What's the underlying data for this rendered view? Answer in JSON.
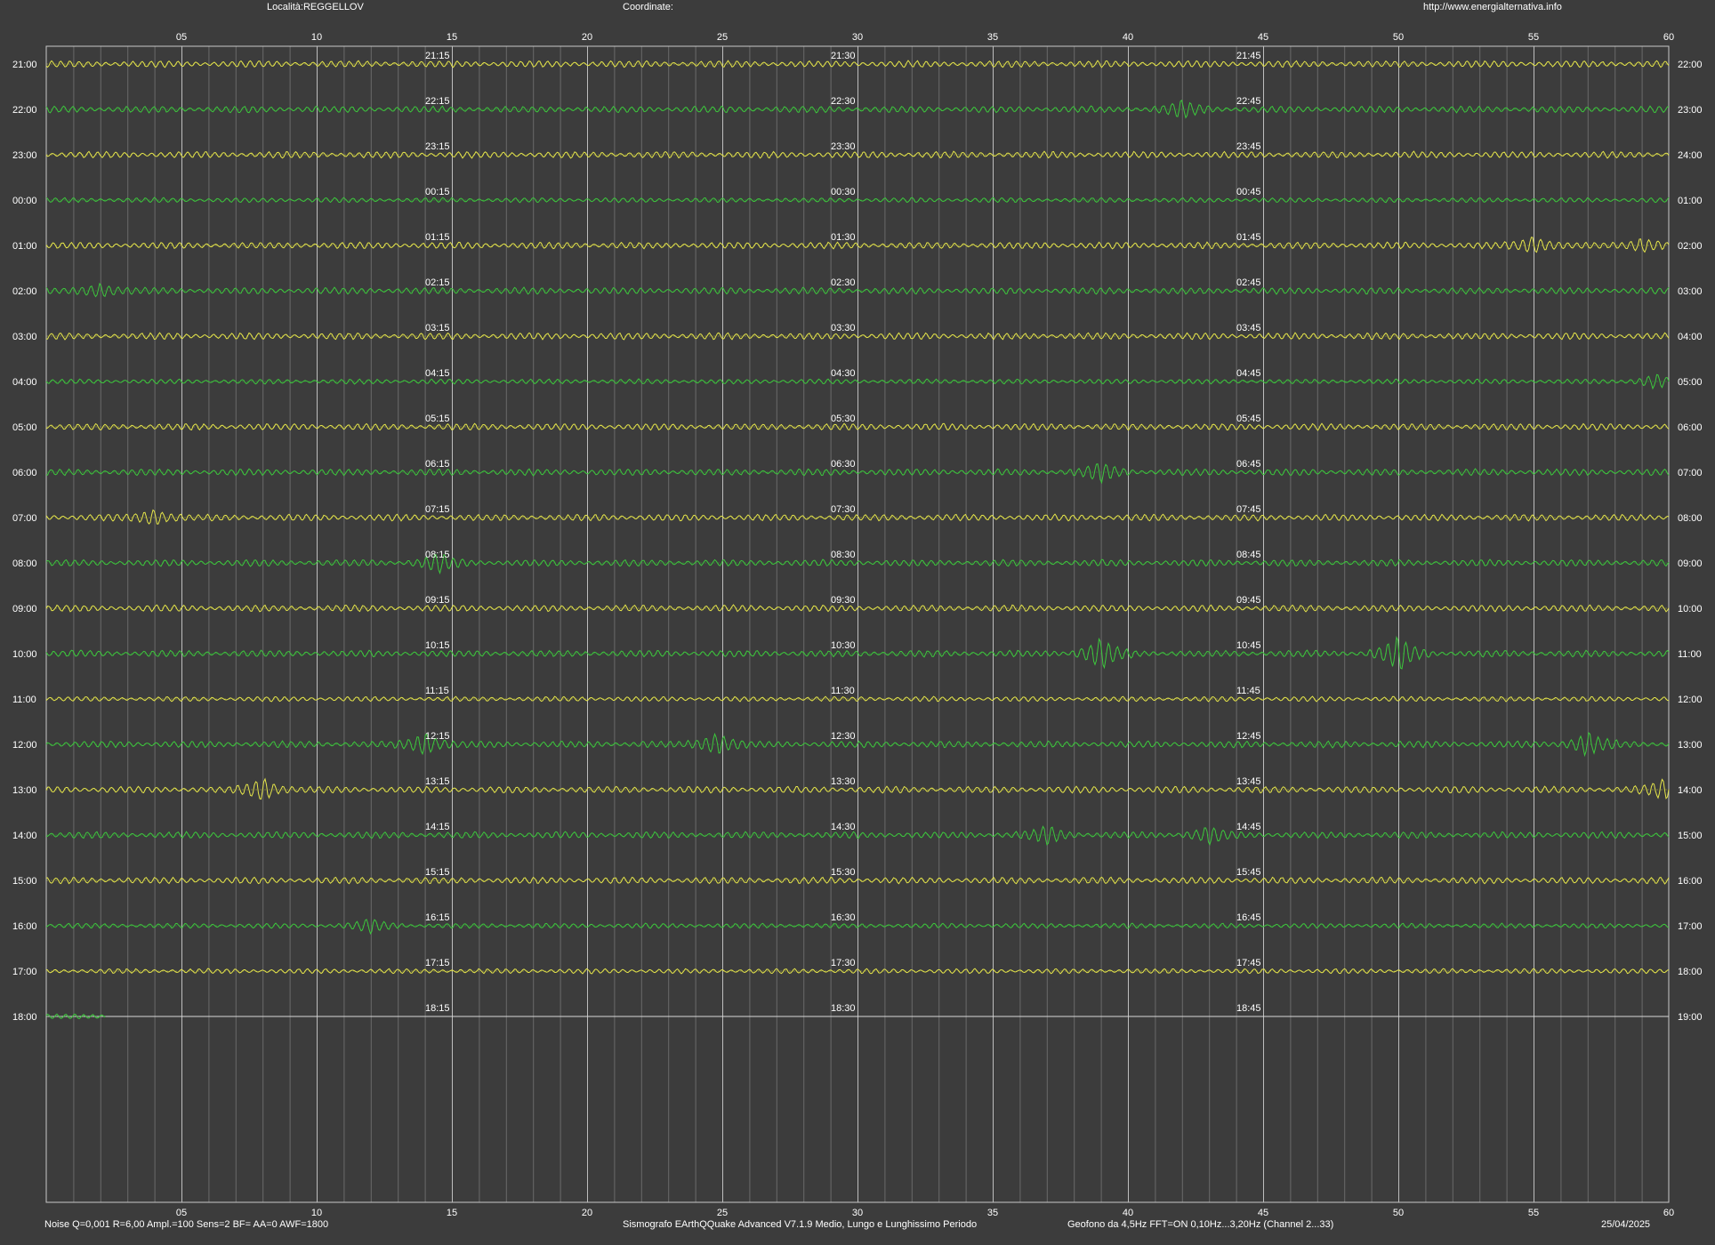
{
  "header": {
    "location": "Località:REGGELLOV",
    "coordinates": "Coordinate:",
    "url": "http://www.energialternativa.info"
  },
  "footer": {
    "noise": "Noise Q=0,001 R=6,00 Ampl.=100 Sens=2 BF= AA=0 AWF=1800",
    "software": "Sismografo  EArthQQuake Advanced V7.1.9  Medio, Lungo e Lunghissimo Periodo",
    "sensor": "Geofono da 4,5Hz FFT=ON 0,10Hz...3,20Hz      (Channel 2...33)",
    "date": "25/04/2025"
  },
  "chart_data": {
    "type": "line",
    "title": "",
    "xlabel": "",
    "ylabel": "",
    "x_ticks": [
      "05",
      "10",
      "15",
      "20",
      "25",
      "30",
      "35",
      "40",
      "45",
      "50",
      "55",
      "60"
    ],
    "xlim": [
      0,
      60
    ],
    "rows": [
      {
        "left": "21:00",
        "right": "22:00",
        "q1": "21:15",
        "q2": "21:30",
        "q3": "21:45",
        "color": "#e6e64a",
        "amp": 4,
        "complete": true,
        "events": []
      },
      {
        "left": "22:00",
        "right": "23:00",
        "q1": "22:15",
        "q2": "22:30",
        "q3": "22:45",
        "color": "#3cc83c",
        "amp": 4,
        "complete": true,
        "events": [
          {
            "minute": 42,
            "amp": 8
          }
        ]
      },
      {
        "left": "23:00",
        "right": "24:00",
        "q1": "23:15",
        "q2": "23:30",
        "q3": "23:45",
        "color": "#e6e64a",
        "amp": 4,
        "complete": true,
        "events": []
      },
      {
        "left": "00:00",
        "right": "01:00",
        "q1": "00:15",
        "q2": "00:30",
        "q3": "00:45",
        "color": "#3cc83c",
        "amp": 3,
        "complete": true,
        "events": []
      },
      {
        "left": "01:00",
        "right": "02:00",
        "q1": "01:15",
        "q2": "01:30",
        "q3": "01:45",
        "color": "#e6e64a",
        "amp": 4,
        "complete": true,
        "events": [
          {
            "minute": 55,
            "amp": 9
          },
          {
            "minute": 59,
            "amp": 7
          }
        ]
      },
      {
        "left": "02:00",
        "right": "03:00",
        "q1": "02:15",
        "q2": "02:30",
        "q3": "02:45",
        "color": "#3cc83c",
        "amp": 4,
        "complete": true,
        "events": [
          {
            "minute": 2,
            "amp": 7
          }
        ]
      },
      {
        "left": "03:00",
        "right": "04:00",
        "q1": "03:15",
        "q2": "03:30",
        "q3": "03:45",
        "color": "#e6e64a",
        "amp": 4,
        "complete": true,
        "events": []
      },
      {
        "left": "04:00",
        "right": "05:00",
        "q1": "04:15",
        "q2": "04:30",
        "q3": "04:45",
        "color": "#3cc83c",
        "amp": 3,
        "complete": true,
        "events": [
          {
            "minute": 59.5,
            "amp": 7
          }
        ]
      },
      {
        "left": "05:00",
        "right": "06:00",
        "q1": "05:15",
        "q2": "05:30",
        "q3": "05:45",
        "color": "#e6e64a",
        "amp": 4,
        "complete": true,
        "events": []
      },
      {
        "left": "06:00",
        "right": "07:00",
        "q1": "06:15",
        "q2": "06:30",
        "q3": "06:45",
        "color": "#3cc83c",
        "amp": 4,
        "complete": true,
        "events": [
          {
            "minute": 39,
            "amp": 9
          }
        ]
      },
      {
        "left": "07:00",
        "right": "08:00",
        "q1": "07:15",
        "q2": "07:30",
        "q3": "07:45",
        "color": "#e6e64a",
        "amp": 4,
        "complete": true,
        "events": [
          {
            "minute": 4,
            "amp": 8
          }
        ]
      },
      {
        "left": "08:00",
        "right": "09:00",
        "q1": "08:15",
        "q2": "08:30",
        "q3": "08:45",
        "color": "#3cc83c",
        "amp": 4,
        "complete": true,
        "events": [
          {
            "minute": 14.5,
            "amp": 9
          }
        ]
      },
      {
        "left": "09:00",
        "right": "10:00",
        "q1": "09:15",
        "q2": "09:30",
        "q3": "09:45",
        "color": "#e6e64a",
        "amp": 4,
        "complete": true,
        "events": []
      },
      {
        "left": "10:00",
        "right": "11:00",
        "q1": "10:15",
        "q2": "10:30",
        "q3": "10:45",
        "color": "#3cc83c",
        "amp": 4,
        "complete": true,
        "events": [
          {
            "minute": 39,
            "amp": 16
          },
          {
            "minute": 50,
            "amp": 18
          }
        ]
      },
      {
        "left": "11:00",
        "right": "12:00",
        "q1": "11:15",
        "q2": "11:30",
        "q3": "11:45",
        "color": "#e6e64a",
        "amp": 3,
        "complete": true,
        "events": []
      },
      {
        "left": "12:00",
        "right": "13:00",
        "q1": "12:15",
        "q2": "12:30",
        "q3": "12:45",
        "color": "#3cc83c",
        "amp": 4,
        "complete": true,
        "events": [
          {
            "minute": 14,
            "amp": 12
          },
          {
            "minute": 24.8,
            "amp": 12
          },
          {
            "minute": 57,
            "amp": 12
          }
        ]
      },
      {
        "left": "13:00",
        "right": "14:00",
        "q1": "13:15",
        "q2": "13:30",
        "q3": "13:45",
        "color": "#e6e64a",
        "amp": 4,
        "complete": true,
        "events": [
          {
            "minute": 8,
            "amp": 12
          },
          {
            "minute": 59.8,
            "amp": 9
          }
        ]
      },
      {
        "left": "14:00",
        "right": "15:00",
        "q1": "14:15",
        "q2": "14:30",
        "q3": "14:45",
        "color": "#3cc83c",
        "amp": 4,
        "complete": true,
        "events": [
          {
            "minute": 37,
            "amp": 9
          },
          {
            "minute": 43,
            "amp": 8
          }
        ]
      },
      {
        "left": "15:00",
        "right": "16:00",
        "q1": "15:15",
        "q2": "15:30",
        "q3": "15:45",
        "color": "#e6e64a",
        "amp": 4,
        "complete": true,
        "events": []
      },
      {
        "left": "16:00",
        "right": "17:00",
        "q1": "16:15",
        "q2": "16:30",
        "q3": "16:45",
        "color": "#3cc83c",
        "amp": 3,
        "complete": true,
        "events": [
          {
            "minute": 12,
            "amp": 7
          }
        ]
      },
      {
        "left": "17:00",
        "right": "18:00",
        "q1": "17:15",
        "q2": "17:30",
        "q3": "17:45",
        "color": "#e6e64a",
        "amp": 3,
        "complete": true,
        "events": []
      },
      {
        "left": "18:00",
        "right": "19:00",
        "q1": "18:15",
        "q2": "18:30",
        "q3": "18:45",
        "color": "#3cc83c",
        "amp": 3,
        "complete": false,
        "end_minute": 2.2,
        "events": []
      }
    ]
  }
}
